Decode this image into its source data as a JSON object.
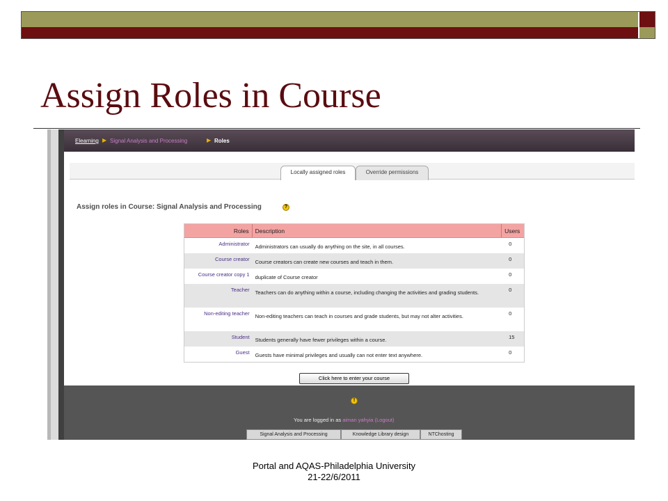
{
  "slide": {
    "title": "Assign Roles in Course",
    "footer_line1": "Portal and AQAS-Philadelphia University",
    "footer_line2": "21-22/6/2011"
  },
  "breadcrumb": {
    "home": "Elearning",
    "course": "Signal Analysis and Processing",
    "current": "Roles",
    "separator": "▶"
  },
  "tabs": [
    {
      "label": "Locally assigned roles",
      "active": true
    },
    {
      "label": "Override permissions",
      "active": false
    }
  ],
  "page_heading": "Assign roles in Course: Signal Analysis and Processing",
  "help_icon": "help-icon",
  "table": {
    "headers": {
      "roles": "Roles",
      "description": "Description",
      "users": "Users"
    },
    "rows": [
      {
        "role": "Administrator",
        "description": "Administrators can usually do anything on the site, in all courses.",
        "users": "0"
      },
      {
        "role": "Course creator",
        "description": "Course creators can create new courses and teach in them.",
        "users": "0"
      },
      {
        "role": "Course creator copy 1",
        "description": "duplicate of Course creator",
        "users": "0"
      },
      {
        "role": "Teacher",
        "description": "Teachers can do anything within a course, including changing the activities and grading students.",
        "users": "0"
      },
      {
        "role": "Non-editing teacher",
        "description": "Non-editing teachers can teach in courses and grade students, but may not alter activities.",
        "users": "0"
      },
      {
        "role": "Student",
        "description": "Students generally have fewer privileges within a course.",
        "users": "15"
      },
      {
        "role": "Guest",
        "description": "Guests have minimal privileges and usually can not enter text anywhere.",
        "users": "0"
      }
    ]
  },
  "enter_button": "Click here to enter your course",
  "footer": {
    "info_icon": "info-icon",
    "logged_prefix": "You are logged in as",
    "user_name": "aiman yahyia",
    "logout": "(Logout)",
    "tabs": [
      "Signal Analysis and Processing",
      "Knowledge Library design",
      "NTChosting"
    ]
  },
  "colors": {
    "slide_maroon": "#6e0f12",
    "slide_olive": "#9b9a5a",
    "title": "#5a0c10",
    "table_header": "#f4a3a3",
    "role_link": "#4a2f86"
  }
}
